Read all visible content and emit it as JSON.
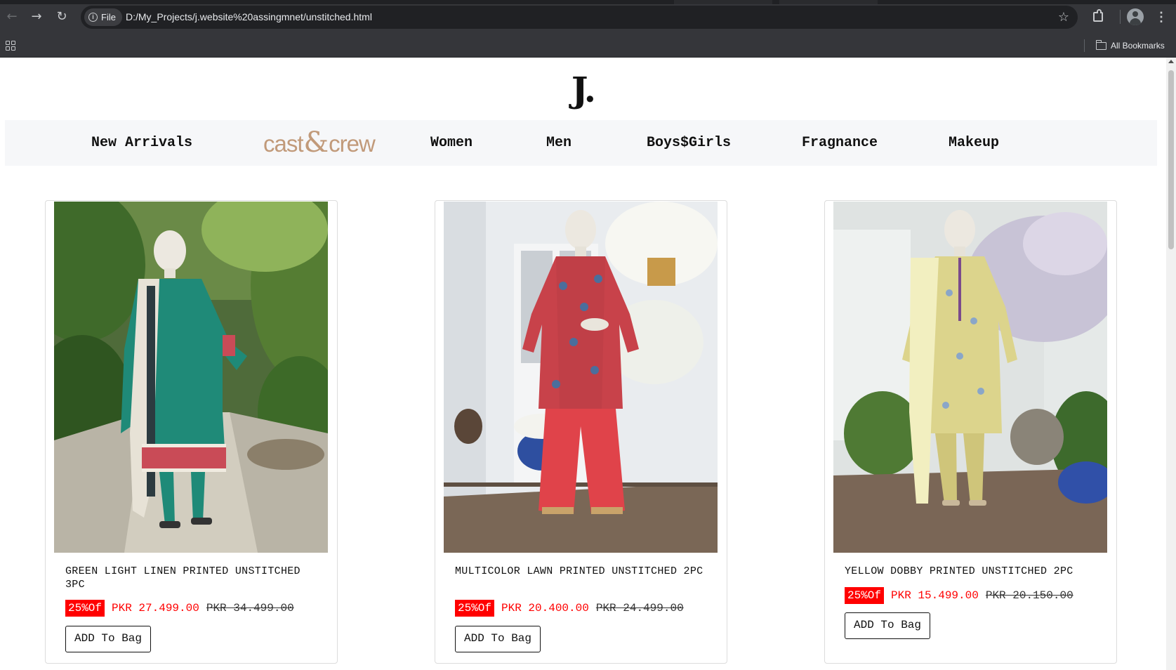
{
  "browser": {
    "url_chip": "File",
    "url": "D:/My_Projects/j.website%20assingmnet/unstitched.html",
    "all_bookmarks": "All Bookmarks"
  },
  "site": {
    "logo": "J."
  },
  "nav": {
    "items": [
      "New Arrivals",
      "Women",
      "Men",
      "Boys$Girls",
      "Fragnance",
      "Makeup"
    ],
    "brand_left": "cast",
    "brand_amp": "&",
    "brand_right": "crew"
  },
  "products": [
    {
      "title": "GREEN LIGHT LINEN PRINTED UNSTITCHED 3PC",
      "badge": "25%Of",
      "price": "PKR 27.499.00",
      "old_price": "PKR 34.499.00",
      "button": "ADD To Bag"
    },
    {
      "title": "MULTICOLOR LAWN PRINTED UNSTITCHED 2PC",
      "badge": "25%Of",
      "price": "PKR 20.400.00",
      "old_price": "PKR 24.499.00",
      "button": "ADD To Bag"
    },
    {
      "title": "YELLOW DOBBY PRINTED UNSTITCHED 2PC",
      "badge": "25%Of",
      "price": "PKR 15.499.00",
      "old_price": "PKR 20.150.00",
      "button": "ADD To Bag"
    }
  ],
  "colors": {
    "accent_red": "#ff0000",
    "brand_tan": "#c19a7a",
    "chrome_dark": "#35363a"
  }
}
